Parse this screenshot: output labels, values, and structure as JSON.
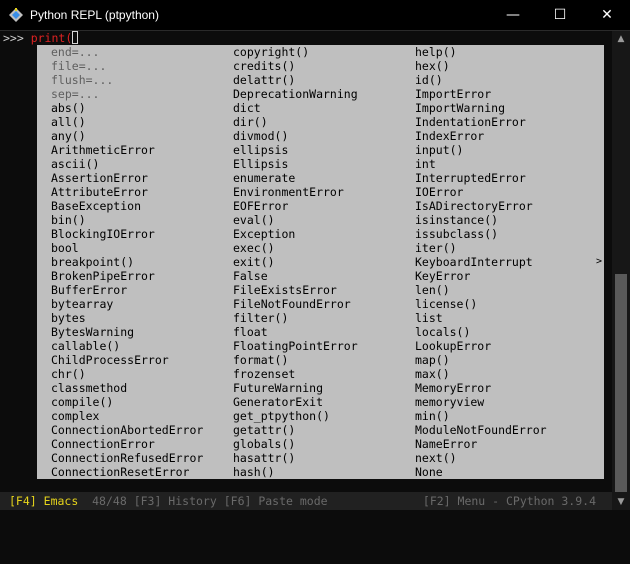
{
  "window": {
    "title": "Python REPL (ptpython)",
    "minimize_glyph": "—",
    "maximize_glyph": "☐",
    "close_glyph": "✕"
  },
  "prompt": {
    "prompt_text": ">>> ",
    "input_text": "print("
  },
  "completions": {
    "columns": [
      [
        "end=...",
        "file=...",
        "flush=...",
        "sep=...",
        "abs()",
        "all()",
        "any()",
        "ArithmeticError",
        "ascii()",
        "AssertionError",
        "AttributeError",
        "BaseException",
        "bin()",
        "BlockingIOError",
        "bool",
        "breakpoint()",
        "BrokenPipeError",
        "BufferError",
        "bytearray",
        "bytes",
        "BytesWarning",
        "callable()",
        "ChildProcessError",
        "chr()",
        "classmethod",
        "compile()",
        "complex",
        "ConnectionAbortedError",
        "ConnectionError",
        "ConnectionRefusedError",
        "ConnectionResetError"
      ],
      [
        "copyright()",
        "credits()",
        "delattr()",
        "DeprecationWarning",
        "dict",
        "dir()",
        "divmod()",
        "ellipsis",
        "Ellipsis",
        "enumerate",
        "EnvironmentError",
        "EOFError",
        "eval()",
        "Exception",
        "exec()",
        "exit()",
        "False",
        "FileExistsError",
        "FileNotFoundError",
        "filter()",
        "float",
        "FloatingPointError",
        "format()",
        "frozenset",
        "FutureWarning",
        "GeneratorExit",
        "get_ptpython()",
        "getattr()",
        "globals()",
        "hasattr()",
        "hash()"
      ],
      [
        "help()",
        "hex()",
        "id()",
        "ImportError",
        "ImportWarning",
        "IndentationError",
        "IndexError",
        "input()",
        "int",
        "InterruptedError",
        "IOError",
        "IsADirectoryError",
        "isinstance()",
        "issubclass()",
        "iter()",
        "KeyboardInterrupt",
        "KeyError",
        "len()",
        "license()",
        "list",
        "locals()",
        "LookupError",
        "map()",
        "max()",
        "MemoryError",
        "memoryview",
        "min()",
        "ModuleNotFoundError",
        "NameError",
        "next()",
        "None"
      ]
    ],
    "meta_items": [
      "end=...",
      "file=...",
      "flush=...",
      "sep=..."
    ],
    "more_indicator": ">"
  },
  "toolbar": {
    "f4_key": "[F4]",
    "mode": "Emacs",
    "count": "48/48",
    "history": "[F3] History",
    "paste": "[F6] Paste mode",
    "right_text": "[F2] Menu - CPython 3.9.4"
  },
  "scrollbar": {
    "up_glyph": "▲",
    "down_glyph": "▼"
  }
}
